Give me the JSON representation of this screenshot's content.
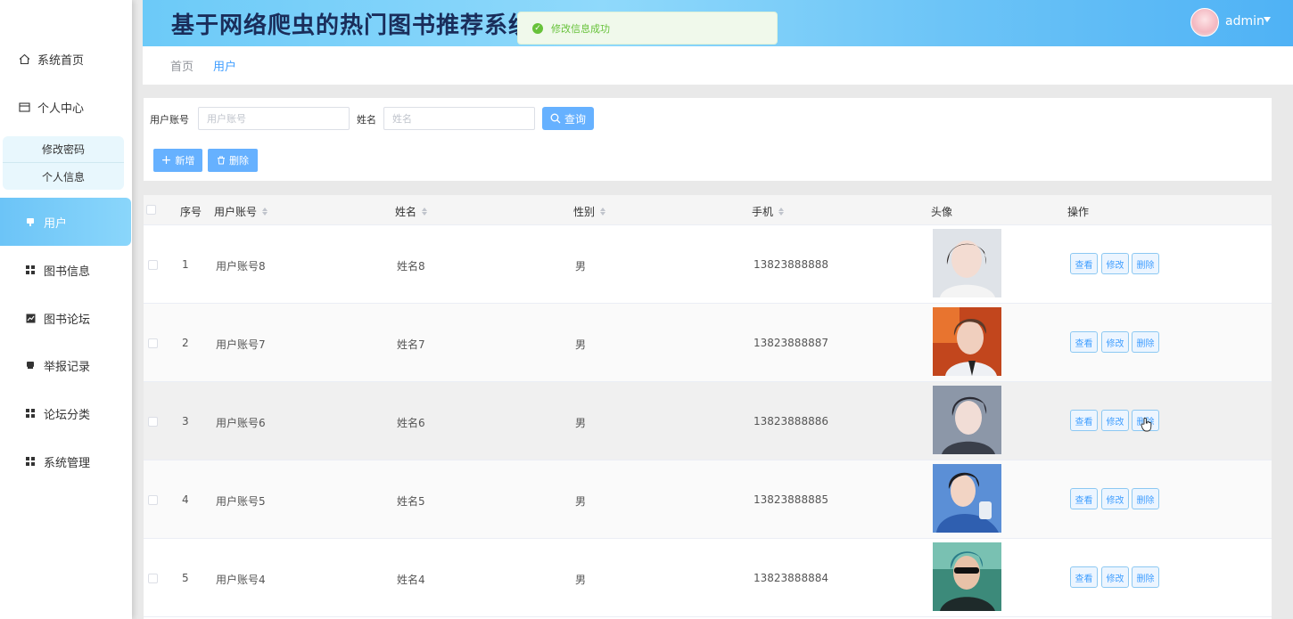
{
  "header": {
    "title": "基于网络爬虫的热门图书推荐系统",
    "user": "admin"
  },
  "toast": {
    "message": "修改信息成功"
  },
  "sidebar": {
    "home": "系统首页",
    "center": "个人中心",
    "sub_items": [
      "修改密码",
      "个人信息"
    ],
    "menu": [
      "用户",
      "图书信息",
      "图书论坛",
      "举报记录",
      "论坛分类",
      "系统管理"
    ]
  },
  "breadcrumb": [
    "首页",
    "用户"
  ],
  "search": {
    "account_label": "用户账号",
    "account_placeholder": "用户账号",
    "name_label": "姓名",
    "name_placeholder": "姓名",
    "query_label": "查询",
    "add_label": "新增",
    "delete_label": "删除"
  },
  "table": {
    "headers": [
      "序号",
      "用户账号",
      "姓名",
      "性别",
      "手机",
      "头像",
      "操作"
    ],
    "rows": [
      {
        "no": "1",
        "account": "用户账号8",
        "name": "姓名8",
        "gender": "男",
        "phone": "13823888888"
      },
      {
        "no": "2",
        "account": "用户账号7",
        "name": "姓名7",
        "gender": "男",
        "phone": "13823888887"
      },
      {
        "no": "3",
        "account": "用户账号6",
        "name": "姓名6",
        "gender": "男",
        "phone": "13823888886"
      },
      {
        "no": "4",
        "account": "用户账号5",
        "name": "姓名5",
        "gender": "男",
        "phone": "13823888885"
      },
      {
        "no": "5",
        "account": "用户账号4",
        "name": "姓名4",
        "gender": "男",
        "phone": "13823888884"
      }
    ],
    "actions": {
      "view": "查看",
      "edit": "修改",
      "delete": "删除"
    }
  },
  "colors": {
    "accent": "#409eff",
    "header_gradient_start": "#6ccaf8",
    "success": "#67c23a"
  }
}
